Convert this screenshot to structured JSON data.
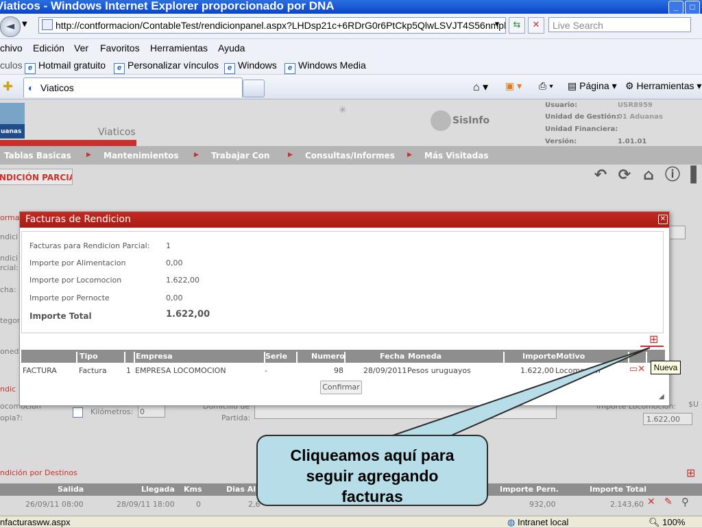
{
  "window": {
    "title": "Viaticos - Windows Internet Explorer proporcionado por DNA"
  },
  "address": {
    "url": "http://contformacion/ContableTest/rendicionpanel.aspx?LHDsp21c+6RDrG0r6PtCkp5QlwLSVJT4S56nmph",
    "search_placeholder": "Live Search"
  },
  "menu": [
    "chivo",
    "Edición",
    "Ver",
    "Favoritos",
    "Herramientas",
    "Ayuda"
  ],
  "links": {
    "label": "culos",
    "items": [
      "Hotmail gratuito",
      "Personalizar vínculos",
      "Windows",
      "Windows Media"
    ]
  },
  "tabs": {
    "active": "Viaticos",
    "commands": [
      "Página",
      "Herramientas"
    ]
  },
  "app": {
    "logo_text": "uanas",
    "title": "Viaticos",
    "brand": "SisInfo",
    "user_info": [
      {
        "label": "Usuario:",
        "value": "USR8959"
      },
      {
        "label": "Unidad de Gestión:",
        "value": "01 Aduanas"
      },
      {
        "label": "Unidad Financiera:",
        "value": ""
      },
      {
        "label": "Versión:",
        "value": "1.01.01"
      }
    ],
    "nav": [
      "Tablas Basicas",
      "Mantenimientos",
      "Trabajar Con",
      "Consultas/Informes",
      "Más Visitadas"
    ],
    "section_button": "NDICIÓN PARCIAL"
  },
  "background_form": {
    "left_labels": [
      "ormac",
      "ndici",
      "ndici",
      "rcial:",
      "cha:",
      "tegor",
      "oneda",
      "ndic",
      "ocomoción",
      "opia?:"
    ],
    "kilometros_label": "Kilómetros:",
    "kilometros_value": "0",
    "domicilio_label_1": "Domicilio de",
    "domicilio_label_2": "Partida:",
    "importe_locomocion_label": "Importe Locomoción:",
    "currency": "$U",
    "importe_locomocion_value": "1.622,00",
    "destinos_title": "ndición por Destinos",
    "destinos_headers": [
      "Salida",
      "Llegada",
      "Kms",
      "Dias Ali",
      "Importe Pern.",
      "Importe Total"
    ],
    "destinos_row": [
      "26/09/11 08:00",
      "28/09/11 18:00",
      "0",
      "2,6",
      "932,00",
      "2.143,60"
    ]
  },
  "modal": {
    "title": "Facturas de Rendicion",
    "summary": [
      {
        "label": "Facturas para Rendicion Parcial:",
        "value": "1"
      },
      {
        "label": "Importe por Alimentacion",
        "value": "0,00"
      },
      {
        "label": "Importe por Locomocion",
        "value": "1.622,00"
      },
      {
        "label": "Importe por Pernocte",
        "value": "0,00"
      },
      {
        "label": "Importe Total",
        "value": "1.622,00"
      }
    ],
    "table": {
      "headers": [
        "Tipo",
        "Empresa",
        "Serie",
        "Numero",
        "Fecha",
        "Moneda",
        "Importe",
        "Motivo"
      ],
      "rows": [
        [
          "FACTURA",
          "Factura",
          "1",
          "EMPRESA LOCOMOCION",
          "-",
          "98",
          "28/09/2011",
          "Pesos uruguayos",
          "1.622,00",
          "Locomocion"
        ]
      ]
    },
    "confirm_label": "Confirmar",
    "tooltip": "Nueva"
  },
  "callout": {
    "line1": "Cliqueamos aquí para",
    "line2": "seguir agregando",
    "line3": "facturas"
  },
  "status": {
    "left": "nfacturasww.aspx",
    "zone": "Intranet local",
    "zoom": "100%"
  }
}
